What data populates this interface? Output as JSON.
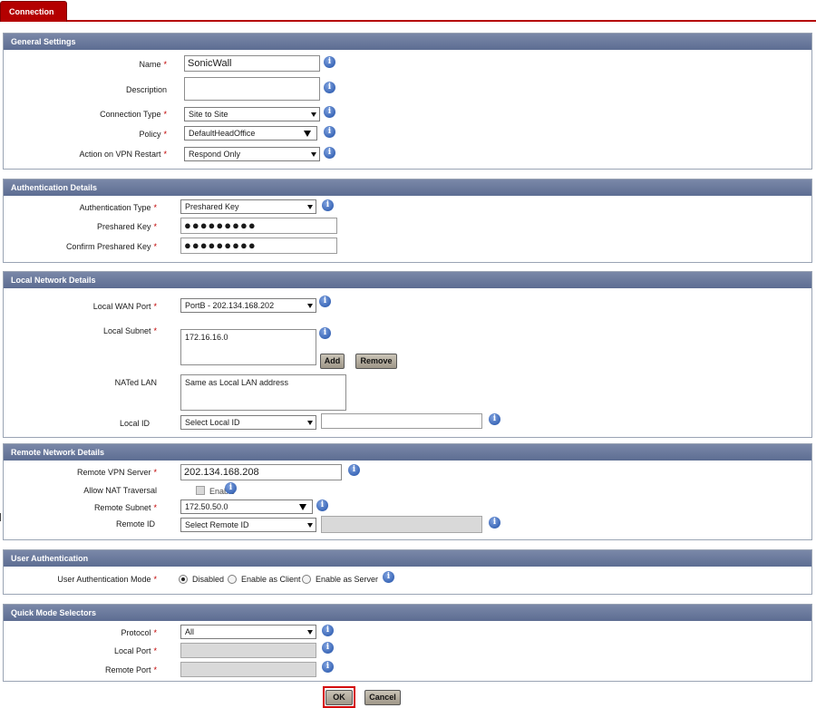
{
  "tab": {
    "label": "Connection"
  },
  "general": {
    "title": "General Settings",
    "name_label": "Name",
    "name_value": "SonicWall",
    "description_label": "Description",
    "conn_type_label": "Connection Type",
    "conn_type_value": "Site to Site",
    "policy_label": "Policy",
    "policy_value": "DefaultHeadOffice",
    "restart_label": "Action on VPN Restart",
    "restart_value": "Respond Only"
  },
  "auth": {
    "title": "Authentication Details",
    "type_label": "Authentication Type",
    "type_value": "Preshared Key",
    "key_label": "Preshared Key",
    "key_value": "●●●●●●●●●",
    "confirm_label": "Confirm Preshared Key",
    "confirm_value": "●●●●●●●●●"
  },
  "local": {
    "title": "Local Network Details",
    "wan_label": "Local WAN Port",
    "wan_value": "PortB - 202.134.168.202",
    "subnet_label": "Local Subnet",
    "subnet_value": "172.16.16.0",
    "add_label": "Add",
    "remove_label": "Remove",
    "nated_label": "NATed LAN",
    "nated_value": "Same as Local LAN address",
    "id_label": "Local ID",
    "id_value": "Select Local ID"
  },
  "remote": {
    "title": "Remote Network Details",
    "server_label": "Remote VPN Server",
    "server_value": "202.134.168.208",
    "nat_label": "Allow NAT Traversal",
    "nat_enable": "Enable",
    "subnet_label": "Remote Subnet",
    "subnet_value": "172.50.50.0",
    "id_label": "Remote ID",
    "id_value": "Select Remote ID"
  },
  "userauth": {
    "title": "User Authentication",
    "mode_label": "User Authentication Mode",
    "opt_disabled": "Disabled",
    "opt_client": "Enable as Client",
    "opt_server": "Enable as Server"
  },
  "quick": {
    "title": "Quick Mode Selectors",
    "protocol_label": "Protocol",
    "protocol_value": "All",
    "lport_label": "Local Port",
    "rport_label": "Remote Port"
  },
  "footer": {
    "ok_label": "OK",
    "cancel_label": "Cancel"
  },
  "required_mark": "*",
  "info_glyph": "i",
  "colors": {
    "accent_red": "#b40000",
    "header_blue": "#6a799c",
    "info_blue": "#1f4fa6"
  }
}
